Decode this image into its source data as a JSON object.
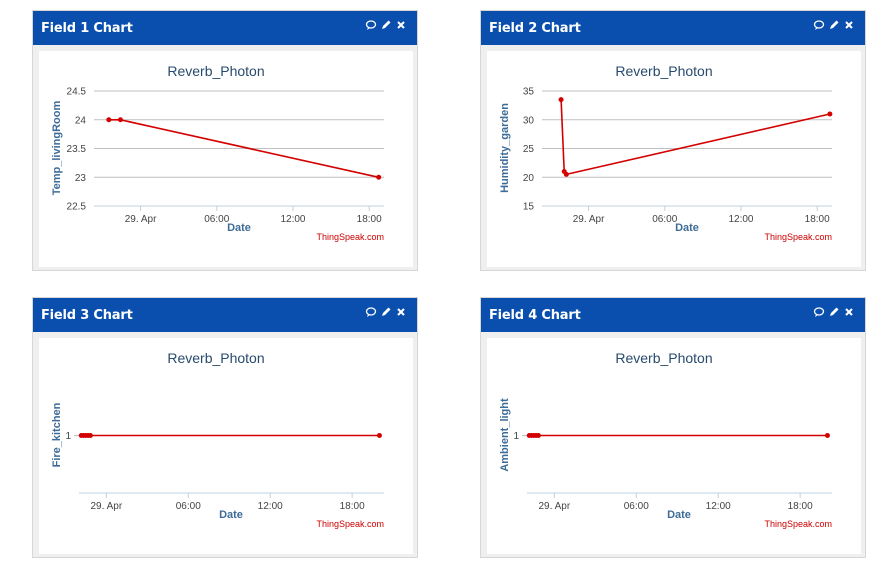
{
  "panels": [
    {
      "header": "Field 1 Chart"
    },
    {
      "header": "Field 2 Chart"
    },
    {
      "header": "Field 3 Chart"
    },
    {
      "header": "Field 4 Chart"
    }
  ],
  "header_icons": [
    "comment-icon",
    "pencil-icon",
    "close-icon"
  ],
  "colors": {
    "header_bg": "#0a4fae",
    "series": "#d40000",
    "credit": "#cc0000"
  },
  "chart_data": [
    {
      "type": "line",
      "title": "Reverb_Photon",
      "xlabel": "Date",
      "ylabel": "Temp_livingRoom",
      "credit": "ThingSpeak.com",
      "ylim": [
        22.5,
        24.5
      ],
      "yticks": [
        "24.5",
        "24",
        "23.5",
        "23",
        "22.5"
      ],
      "xlim": [
        "2016-04-28T20:20",
        "2016-04-29T19:10"
      ],
      "xticks": [
        {
          "t": "2016-04-29T00:00",
          "label": "29. Apr"
        },
        {
          "t": "2016-04-29T06:00",
          "label": "06:00"
        },
        {
          "t": "2016-04-29T12:00",
          "label": "12:00"
        },
        {
          "t": "2016-04-29T18:00",
          "label": "18:00"
        }
      ],
      "grid": true,
      "legend": "none",
      "series": [
        {
          "color": "#d40000",
          "points": [
            [
              "2016-04-28T21:30",
              24.0
            ],
            [
              "2016-04-28T22:25",
              24.0
            ],
            [
              "2016-04-29T18:45",
              23.0
            ]
          ]
        }
      ]
    },
    {
      "type": "line",
      "title": "Reverb_Photon",
      "xlabel": "Date",
      "ylabel": "Humidity_garden",
      "credit": "ThingSpeak.com",
      "ylim": [
        15,
        35
      ],
      "yticks": [
        "35",
        "30",
        "25",
        "20",
        "15"
      ],
      "xlim": [
        "2016-04-28T20:20",
        "2016-04-29T19:10"
      ],
      "xticks": [
        {
          "t": "2016-04-29T00:00",
          "label": "29. Apr"
        },
        {
          "t": "2016-04-29T06:00",
          "label": "06:00"
        },
        {
          "t": "2016-04-29T12:00",
          "label": "12:00"
        },
        {
          "t": "2016-04-29T18:00",
          "label": "18:00"
        }
      ],
      "grid": true,
      "legend": "none",
      "series": [
        {
          "color": "#d40000",
          "points": [
            [
              "2016-04-28T21:50",
              33.5
            ],
            [
              "2016-04-28T22:05",
              21.0
            ],
            [
              "2016-04-28T22:15",
              20.5
            ],
            [
              "2016-04-29T19:00",
              31.0
            ]
          ]
        }
      ]
    },
    {
      "type": "line",
      "title": "Reverb_Photon",
      "xlabel": "Date",
      "ylabel": "Fire_kitchen",
      "credit": "ThingSpeak.com",
      "ylim": [
        0,
        2
      ],
      "yticks": [
        "1"
      ],
      "ytick_values": [
        1
      ],
      "xlim": [
        "2016-04-28T22:00",
        "2016-04-29T20:20"
      ],
      "xticks": [
        {
          "t": "2016-04-29T00:00",
          "label": "29. Apr"
        },
        {
          "t": "2016-04-29T06:00",
          "label": "06:00"
        },
        {
          "t": "2016-04-29T12:00",
          "label": "12:00"
        },
        {
          "t": "2016-04-29T18:00",
          "label": "18:00"
        }
      ],
      "grid": false,
      "legend": "none",
      "series": [
        {
          "color": "#d40000",
          "points": [
            [
              "2016-04-28T22:10",
              1
            ],
            [
              "2016-04-28T22:20",
              1
            ],
            [
              "2016-04-28T22:30",
              1
            ],
            [
              "2016-04-28T22:40",
              1
            ],
            [
              "2016-04-28T22:50",
              1
            ],
            [
              "2016-04-29T20:00",
              1
            ]
          ]
        }
      ]
    },
    {
      "type": "line",
      "title": "Reverb_Photon",
      "xlabel": "Date",
      "ylabel": "Ambient_light",
      "credit": "ThingSpeak.com",
      "ylim": [
        0,
        2
      ],
      "yticks": [
        "1"
      ],
      "ytick_values": [
        1
      ],
      "xlim": [
        "2016-04-28T22:00",
        "2016-04-29T20:20"
      ],
      "xticks": [
        {
          "t": "2016-04-29T00:00",
          "label": "29. Apr"
        },
        {
          "t": "2016-04-29T06:00",
          "label": "06:00"
        },
        {
          "t": "2016-04-29T12:00",
          "label": "12:00"
        },
        {
          "t": "2016-04-29T18:00",
          "label": "18:00"
        }
      ],
      "grid": false,
      "legend": "none",
      "series": [
        {
          "color": "#d40000",
          "points": [
            [
              "2016-04-28T22:10",
              1
            ],
            [
              "2016-04-28T22:20",
              1
            ],
            [
              "2016-04-28T22:30",
              1
            ],
            [
              "2016-04-28T22:40",
              1
            ],
            [
              "2016-04-28T22:50",
              1
            ],
            [
              "2016-04-29T20:00",
              1
            ]
          ]
        }
      ]
    }
  ]
}
